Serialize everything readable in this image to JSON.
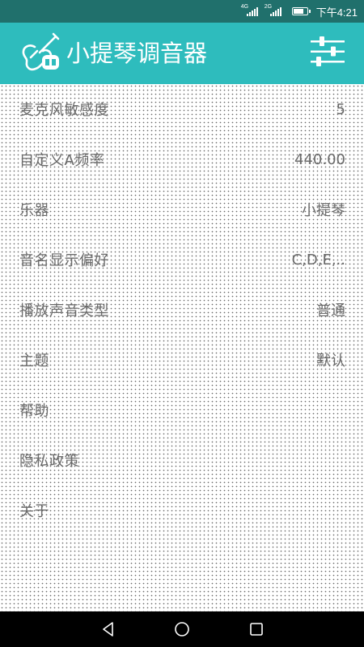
{
  "status_bar": {
    "signal1_tag": "4G",
    "signal2_tag": "2G",
    "battery_level": 0.8,
    "time": "下午4:21"
  },
  "app_bar": {
    "title": "小提琴调音器",
    "logo_icon": "violin-icon",
    "settings_icon": "sliders-icon",
    "color": "#2ebcbd"
  },
  "settings": [
    {
      "label": "麦克风敏感度",
      "value": "5"
    },
    {
      "label": "自定义A频率",
      "value": "440.00"
    },
    {
      "label": "乐器",
      "value": "小提琴"
    },
    {
      "label": "音名显示偏好",
      "value": "C,D,E,.."
    },
    {
      "label": "播放声音类型",
      "value": "普通"
    },
    {
      "label": "主题",
      "value": "默认"
    },
    {
      "label": "帮助",
      "value": ""
    },
    {
      "label": "隐私政策",
      "value": ""
    },
    {
      "label": "关于",
      "value": ""
    }
  ],
  "nav_bar": {
    "back_icon": "back-triangle-icon",
    "home_icon": "home-circle-icon",
    "recents_icon": "recents-square-icon"
  }
}
